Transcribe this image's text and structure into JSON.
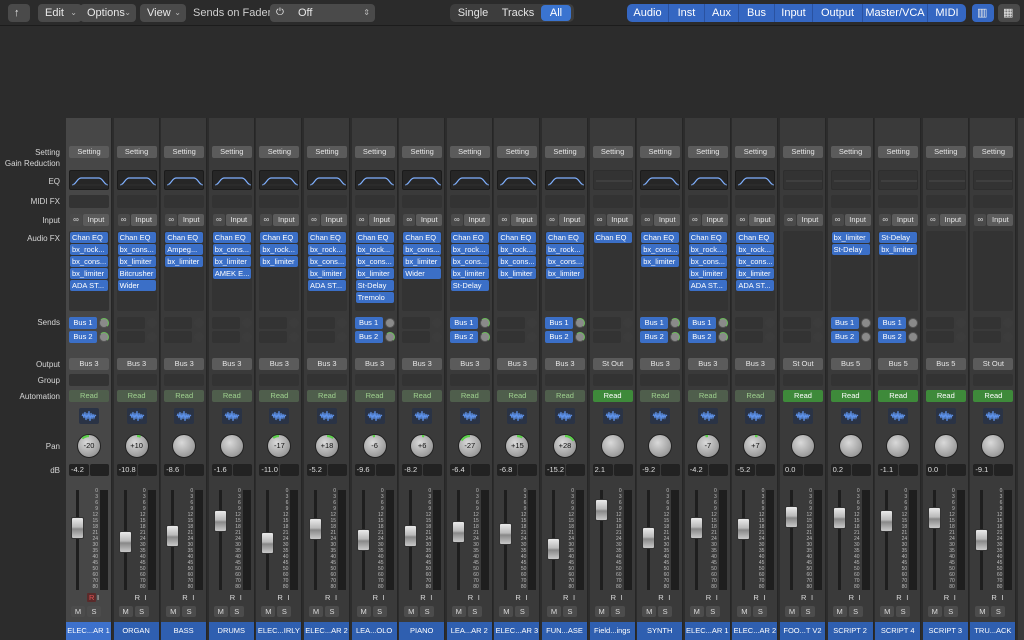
{
  "toolbar": {
    "back_icon": "up-arrow-icon",
    "menus": [
      "Edit",
      "Options",
      "View"
    ],
    "sends_on_faders_label": "Sends on Faders:",
    "sends_on_faders_value": "Off",
    "view_filter": [
      "Single",
      "Tracks",
      "All"
    ],
    "view_filter_selected": "All",
    "channel_types": [
      "Audio",
      "Inst",
      "Aux",
      "Bus",
      "Input",
      "Output",
      "Master/VCA",
      "MIDI"
    ]
  },
  "row_labels": {
    "setting": "Setting",
    "gain_reduction": "Gain Reduction",
    "eq": "EQ",
    "midi_fx": "MIDI FX",
    "input": "Input",
    "audio_fx": "Audio FX",
    "sends": "Sends",
    "output": "Output",
    "group": "Group",
    "automation": "Automation",
    "pan": "Pan",
    "db": "dB"
  },
  "strip_common": {
    "setting_label": "Setting",
    "input_label": "Input",
    "mute_label": "M",
    "solo_label": "S",
    "record_label": "R",
    "input_monitor_label": "I",
    "automation_label": "Read"
  },
  "fader_scale": [
    "0",
    "3",
    "6",
    "9",
    "12",
    "15",
    "18",
    "21",
    "24",
    "30",
    "35",
    "40",
    "45",
    "50",
    "60",
    "70",
    "80"
  ],
  "strips": [
    {
      "name": "ELEC...AR 1",
      "eq": true,
      "fx": [
        "Chan EQ",
        "bx_rock...",
        "bx_cons...",
        "bx_limiter",
        "ADA ST..."
      ],
      "sends": [
        {
          "label": "Bus 1",
          "knob": "green"
        },
        {
          "label": "Bus 2",
          "knob": "green"
        }
      ],
      "output": "Bus 3",
      "auto_bright": false,
      "pan": "-20",
      "db": "-4.2",
      "fader": 0.66,
      "selected": true,
      "record": true
    },
    {
      "name": "ORGAN",
      "eq": true,
      "fx": [
        "Chan EQ",
        "bx_cons...",
        "bx_limiter",
        "Bitcrusher",
        "Wider"
      ],
      "sends": [
        null,
        null
      ],
      "output": "Bus 3",
      "auto_bright": false,
      "pan": "+10",
      "db": "-10.8",
      "fader": 0.48
    },
    {
      "name": "BASS",
      "eq": true,
      "fx": [
        "Chan EQ",
        "Ampeg...",
        "bx_limiter"
      ],
      "sends": [
        null,
        null
      ],
      "output": "Bus 3",
      "auto_bright": false,
      "pan": "",
      "db": "-8.6",
      "fader": 0.55
    },
    {
      "name": "DRUMS",
      "eq": true,
      "fx": [
        "Chan EQ",
        "bx_cons...",
        "bx_limiter",
        "AMEK E..."
      ],
      "sends": [
        null,
        null
      ],
      "output": "Bus 3",
      "auto_bright": false,
      "pan": "",
      "db": "-1.6",
      "fader": 0.75
    },
    {
      "name": "ELEC...IRLY",
      "eq": true,
      "fx": [
        "Chan EQ",
        "bx_rock...",
        "bx_limiter"
      ],
      "sends": [
        null,
        null
      ],
      "output": "Bus 3",
      "auto_bright": false,
      "pan": "-17",
      "db": "-11.0",
      "fader": 0.46
    },
    {
      "name": "ELEC...AR 2",
      "eq": true,
      "fx": [
        "Chan EQ",
        "bx_rock...",
        "bx_cons...",
        "bx_limiter",
        "ADA ST..."
      ],
      "sends": [
        null,
        null
      ],
      "output": "Bus 3",
      "auto_bright": false,
      "pan": "+18",
      "db": "-5.2",
      "fader": 0.64
    },
    {
      "name": "LEA...OLO",
      "eq": true,
      "fx": [
        "Chan EQ",
        "bx_rock...",
        "bx_cons...",
        "bx_limiter",
        "St-Delay",
        "Tremolo"
      ],
      "sends": [
        {
          "label": "Bus 1",
          "knob": "plain"
        },
        {
          "label": "Bus 2",
          "knob": "green"
        }
      ],
      "output": "Bus 3",
      "auto_bright": false,
      "pan": "-6",
      "db": "-9.6",
      "fader": 0.5
    },
    {
      "name": "PIANO",
      "eq": true,
      "fx": [
        "Chan EQ",
        "bx_cons...",
        "bx_limiter",
        "Wider"
      ],
      "sends": [
        null,
        null
      ],
      "output": "Bus 3",
      "auto_bright": false,
      "pan": "+6",
      "db": "-8.2",
      "fader": 0.55
    },
    {
      "name": "LEA...AR 2",
      "eq": true,
      "fx": [
        "Chan EQ",
        "bx_rock...",
        "bx_cons...",
        "bx_limiter",
        "St-Delay"
      ],
      "sends": [
        {
          "label": "Bus 1",
          "knob": "green"
        },
        {
          "label": "Bus 2",
          "knob": "green"
        }
      ],
      "output": "Bus 3",
      "auto_bright": false,
      "pan": "-27",
      "db": "-6.4",
      "fader": 0.6
    },
    {
      "name": "ELEC...AR 3",
      "eq": true,
      "fx": [
        "Chan EQ",
        "bx_rock...",
        "bx_cons...",
        "bx_limiter"
      ],
      "sends": [
        null,
        null
      ],
      "output": "Bus 3",
      "auto_bright": false,
      "pan": "+15",
      "db": "-6.8",
      "fader": 0.58
    },
    {
      "name": "FUN...ASE",
      "eq": true,
      "fx": [
        "Chan EQ",
        "bx_rock...",
        "bx_cons...",
        "bx_limiter"
      ],
      "sends": [
        {
          "label": "Bus 1",
          "knob": "green"
        },
        {
          "label": "Bus 2",
          "knob": "green"
        }
      ],
      "output": "Bus 3",
      "auto_bright": false,
      "pan": "+28",
      "db": "-15.2",
      "fader": 0.38
    },
    {
      "name": "Field...ings",
      "eq": false,
      "fx": [
        "Chan EQ"
      ],
      "sends": [
        null,
        null
      ],
      "output": "St Out",
      "auto_bright": true,
      "pan": "",
      "db": "2.1",
      "fader": 0.88
    },
    {
      "name": "SYNTH",
      "eq": true,
      "fx": [
        "Chan EQ",
        "bx_cons...",
        "bx_limiter"
      ],
      "sends": [
        {
          "label": "Bus 1",
          "knob": "green"
        },
        {
          "label": "Bus 2",
          "knob": "green"
        }
      ],
      "output": "Bus 3",
      "auto_bright": false,
      "pan": "",
      "db": "-9.2",
      "fader": 0.52
    },
    {
      "name": "ELEC...AR 1",
      "eq": true,
      "fx": [
        "Chan EQ",
        "bx_rock...",
        "bx_cons...",
        "bx_limiter",
        "ADA ST..."
      ],
      "sends": [
        {
          "label": "Bus 1",
          "knob": "green"
        },
        {
          "label": "Bus 2",
          "knob": "green"
        }
      ],
      "output": "Bus 3",
      "auto_bright": false,
      "pan": "-7",
      "db": "-4.2",
      "fader": 0.66
    },
    {
      "name": "ELEC...AR 2",
      "eq": true,
      "fx": [
        "Chan EQ",
        "bx_rock...",
        "bx_cons...",
        "bx_limiter",
        "ADA ST..."
      ],
      "sends": [
        null,
        null
      ],
      "output": "Bus 3",
      "auto_bright": false,
      "pan": "+7",
      "db": "-5.2",
      "fader": 0.64
    },
    {
      "name": "FOO...T V2",
      "eq": false,
      "fx": [],
      "sends": [
        null,
        null
      ],
      "output": "St Out",
      "auto_bright": true,
      "pan": "",
      "db": "0.0",
      "fader": 0.8
    },
    {
      "name": "SCRIPT 2",
      "eq": false,
      "fx": [
        "bx_limiter",
        "St-Delay"
      ],
      "sends": [
        {
          "label": "Bus 1",
          "knob": "plain"
        },
        {
          "label": "Bus 2",
          "knob": "plain"
        }
      ],
      "output": "Bus 5",
      "auto_bright": true,
      "pan": "",
      "db": "0.2",
      "fader": 0.78
    },
    {
      "name": "SCRIPT 4",
      "eq": false,
      "fx": [
        "St-Delay",
        "bx_limiter"
      ],
      "sends": [
        {
          "label": "Bus 1",
          "knob": "plain"
        },
        {
          "label": "Bus 2",
          "knob": "plain"
        }
      ],
      "output": "Bus 5",
      "auto_bright": true,
      "pan": "",
      "db": "-1.1",
      "fader": 0.74
    },
    {
      "name": "SCRIPT 3",
      "eq": false,
      "fx": [],
      "sends": [
        null,
        null
      ],
      "output": "Bus 5",
      "auto_bright": true,
      "pan": "",
      "db": "0.0",
      "fader": 0.78
    },
    {
      "name": "TRU...ACK",
      "eq": false,
      "fx": [],
      "sends": [
        null,
        null
      ],
      "output": "St Out",
      "auto_bright": true,
      "pan": "",
      "db": "-9.1",
      "fader": 0.5
    }
  ]
}
